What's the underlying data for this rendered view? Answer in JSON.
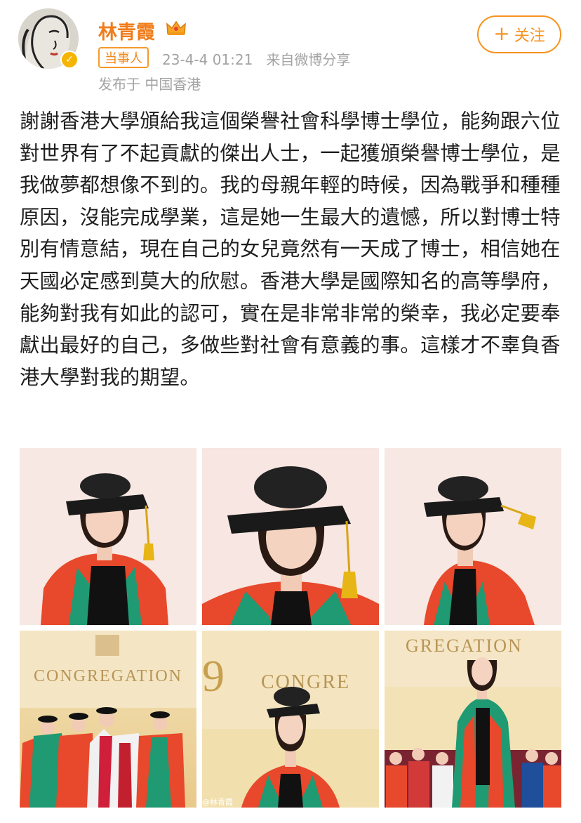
{
  "user": {
    "name": "林青霞",
    "role_badge": "当事人",
    "timestamp": "23-4-4 01:21",
    "source": "来自微博分享",
    "location": "发布于 中国香港"
  },
  "follow": {
    "label": "关注",
    "plus": "+"
  },
  "post": {
    "text": "謝謝香港大學頒給我這個榮譽社會科學博士學位，能夠跟六位對世界有了不起貢獻的傑出人士，一起獲頒榮譽博士學位，是我做夢都想像不到的。我的母親年輕的時候，因為戰爭和種種原因，沒能完成學業，這是她一生最大的遺憾，所以對博士特別有情意結，現在自己的女兒竟然有一天成了博士，相信她在天國必定感到莫大的欣慰。香港大學是國際知名的高等學府，能夠對我有如此的認可，實在是非常非常的榮幸，我必定要奉獻出最好的自己，多做些對社會有意義的事。這樣才不辜負香港大學對我的期望。"
  },
  "photos": {
    "banner_word": "CONGREGATION",
    "banner_word_partial": "CONGRE",
    "banner_word_top": "GREGATION",
    "banner_number": "9",
    "watermark": "@林青霞"
  },
  "colors": {
    "accent": "#f7931e",
    "username": "#f07c1a",
    "meta_gray": "#a3a3a3",
    "gown_red": "#e8482b",
    "gown_green": "#1f9a73"
  },
  "icons": [
    "avatar",
    "verified-icon",
    "crown-icon",
    "plus-icon"
  ]
}
